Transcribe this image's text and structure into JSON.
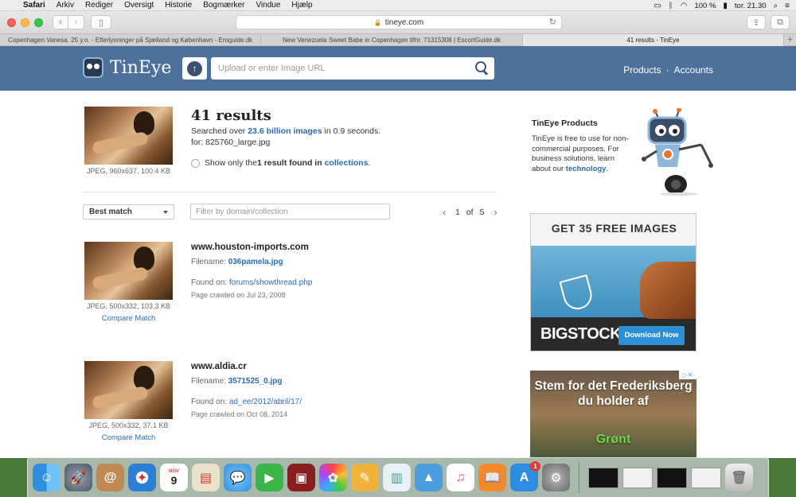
{
  "menubar": {
    "apple": "",
    "items": [
      "Safari",
      "Arkiv",
      "Rediger",
      "Oversigt",
      "Historie",
      "Bogmærker",
      "Vindue",
      "Hjælp"
    ],
    "battery": "100 %",
    "clock": "tor. 21.30"
  },
  "toolbar": {
    "url": "tineye.com"
  },
  "tabs": [
    "Copenhagen.Vanesa. 25 y.o. - Efterlysninger på Sjælland og København - Eroguide.dk",
    "New Venezuela Sweet Babe in Copenhagen tlfnr. 71315308 | EscortGuide.dk",
    "41 results - TinEye"
  ],
  "header": {
    "logo": "TinEye",
    "search_placeholder": "Upload or enter Image URL",
    "links": [
      "Products",
      "Accounts"
    ],
    "link_separator": "·"
  },
  "summary": {
    "query_meta": "JPEG, 960x637, 100.4 KB",
    "title": "41 results",
    "searched_prefix": "Searched over ",
    "searched_count": "23.6 billion images",
    "searched_suffix": " in 0.9 seconds.",
    "for_file": "for: 825760_large.jpg",
    "only_prefix": "Show only the ",
    "only_bold": "1 result found in",
    "only_link": "collections",
    "only_suffix": "."
  },
  "controls": {
    "sort": "Best match",
    "filter_placeholder": "Filter by domain/collection",
    "page_current": "1",
    "page_of": "of",
    "page_total": "5"
  },
  "results": [
    {
      "domain": "www.houston-imports.com",
      "filename_label": "Filename: ",
      "filename": "036pamela.jpg",
      "found_label": "Found on: ",
      "found_on": "forums/showthread.php",
      "crawled": "Page crawled on Jul 23, 2008",
      "meta": "JPEG, 500x332, 103.3 KB",
      "compare": "Compare Match"
    },
    {
      "domain": "www.aldia.cr",
      "filename_label": "Filename: ",
      "filename": "3571525_0.jpg",
      "found_label": "Found on: ",
      "found_on": "ad_ee/2012/abril/17/",
      "crawled": "Page crawled on Oct 08, 2014",
      "meta": "JPEG, 500x332, 37.1 KB",
      "compare": "Compare Match"
    }
  ],
  "sidebar": {
    "title": "TinEye Products",
    "text": "TinEye is free to use for non-commercial purposes. For business solutions, learn about our ",
    "link": "technology",
    "text_end": "."
  },
  "ads": {
    "bigstock_headline": "GET 35 FREE IMAGES",
    "bigstock_brand": "BIGSTOCK",
    "bigstock_button": "Download Now",
    "politic_text": "Stem for det Frederiksberg du holder af",
    "politic_party": "Grønt"
  },
  "dock": {
    "calendar_month": "NOV",
    "calendar_day": "9",
    "appstore_badge": "1"
  },
  "colors": {
    "header_bg": "#4e709c",
    "link": "#2b6cb0"
  }
}
